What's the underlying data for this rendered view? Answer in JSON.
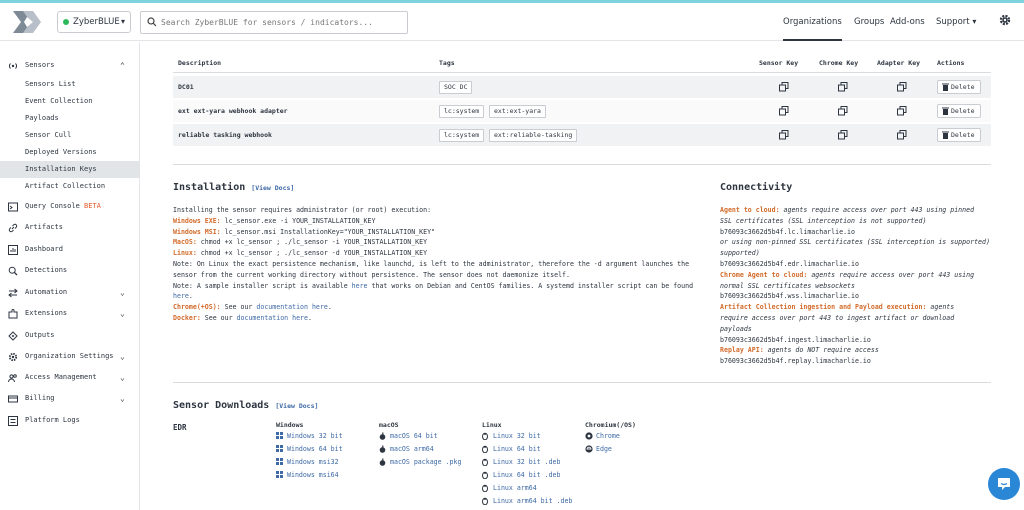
{
  "header": {
    "org_name": "ZyberBLUE",
    "search_placeholder": "Search ZyberBLUE for sensors / indicators...",
    "nav": [
      "Organizations",
      "Groups",
      "Add-ons",
      "Support"
    ]
  },
  "sidebar": {
    "sensors": "Sensors",
    "sensor_items": [
      "Sensors List",
      "Event Collection",
      "Payloads",
      "Sensor Cull",
      "Deployed Versions",
      "Installation Keys",
      "Artifact Collection"
    ],
    "query_console": "Query Console",
    "beta": "BETA",
    "groups": [
      "Artifacts",
      "Dashboard",
      "Detections",
      "Automation",
      "Extensions",
      "Outputs",
      "Organization Settings",
      "Access Management",
      "Billing",
      "Platform Logs"
    ]
  },
  "table": {
    "headers": [
      "Description",
      "Tags",
      "Sensor Key",
      "Chrome Key",
      "Adapter Key",
      "Actions"
    ],
    "rows": [
      {
        "desc": "DC01",
        "tags": [
          "SOC DC"
        ]
      },
      {
        "desc": "ext ext-yara webhook adapter",
        "tags": [
          "lc:system",
          "ext:ext-yara"
        ]
      },
      {
        "desc": "reliable tasking webhook",
        "tags": [
          "lc:system",
          "ext:reliable-tasking"
        ]
      }
    ],
    "delete_label": "Delete"
  },
  "installation": {
    "title": "Installation",
    "view_docs": "[View Docs]",
    "intro": "Installing the sensor requires administrator (or root) execution:",
    "win_exe_label": "Windows EXE:",
    "win_exe": " lc_sensor.exe -i YOUR_INSTALLATION_KEY",
    "win_msi_label": "Windows MSI:",
    "win_msi": " lc_sensor.msi InstallationKey=\"YOUR_INSTALLATION_KEY\"",
    "macos_label": "MacOS:",
    "macos": " chmod +x lc_sensor ; ./lc_sensor -i YOUR_INSTALLATION_KEY",
    "linux_label": "Linux:",
    "linux": " chmod +x lc_sensor ; ./lc_sensor -d YOUR_INSTALLATION_KEY",
    "note1a": "Note: On Linux the exact persistence mechanism, like launchd, is left to the administrator, therefore the -d argument launches the",
    "note1b": "sensor from the current working directory without persistence. The sensor does not daemonize itself.",
    "note2a_pre": "Note: A sample installer script is available ",
    "note2a_link": "here",
    "note2a_post": " that works on Debian and CentOS families. A systemd installer script can be found",
    "note2b_link": "here",
    "note2b_post": ".",
    "chrome_label": "Chrome(+OS):",
    "chrome_pre": " See our ",
    "chrome_link": "documentation here",
    "chrome_post": ".",
    "docker_label": "Docker:",
    "docker_pre": " See our ",
    "docker_link": "documentation here",
    "docker_post": "."
  },
  "connectivity": {
    "title": "Connectivity",
    "a_label": "Agent to cloud:",
    "a_text1": " agents require access over port 443 using pinned",
    "a_text2": "SSL certificates (SSL interception is not supported)",
    "a_host": "b76093c3662d5b4f.lc.limacharlie.io",
    "a_alt1": "or using non-pinned SSL certificates (SSL interception is supported)",
    "a_host2": "b76093c3662d5b4f.edr.limacharlie.io",
    "c_label": "Chrome Agent to cloud:",
    "c_text1": " agents require access over port 443 using",
    "c_text2": "normal SSL certificates websockets",
    "c_host": "b76093c3662d5b4f.wss.limacharlie.io",
    "ac_label": "Artifact Collection ingestion and Payload execution:",
    "ac_text1": " agents",
    "ac_text2": "require access over port 443 to ingest artifact or download",
    "ac_text3": "payloads",
    "ac_host": "b76093c3662d5b4f.ingest.limacharlie.io",
    "r_label": "Replay API:",
    "r_text": " agents do NOT require access",
    "r_host": "b76093c3662d5b4f.replay.limacharlie.io"
  },
  "downloads": {
    "title": "Sensor Downloads",
    "view_docs": "[View Docs]",
    "edr": "EDR",
    "windows": {
      "label": "Windows",
      "items": [
        "Windows 32 bit",
        "Windows 64 bit",
        "Windows msi32",
        "Windows msi64"
      ]
    },
    "macos": {
      "label": "macOS",
      "items": [
        "macOS 64 bit",
        "macOS arm64",
        "macOS package .pkg"
      ]
    },
    "linux": {
      "label": "Linux",
      "items": [
        "Linux 32 bit",
        "Linux 64 bit",
        "Linux 32 bit .deb",
        "Linux 64 bit .deb",
        "Linux arm64",
        "Linux arm64 bit .deb"
      ]
    },
    "chromium": {
      "label": "Chromium(/OS)",
      "items": [
        "Chrome",
        "Edge"
      ]
    }
  }
}
